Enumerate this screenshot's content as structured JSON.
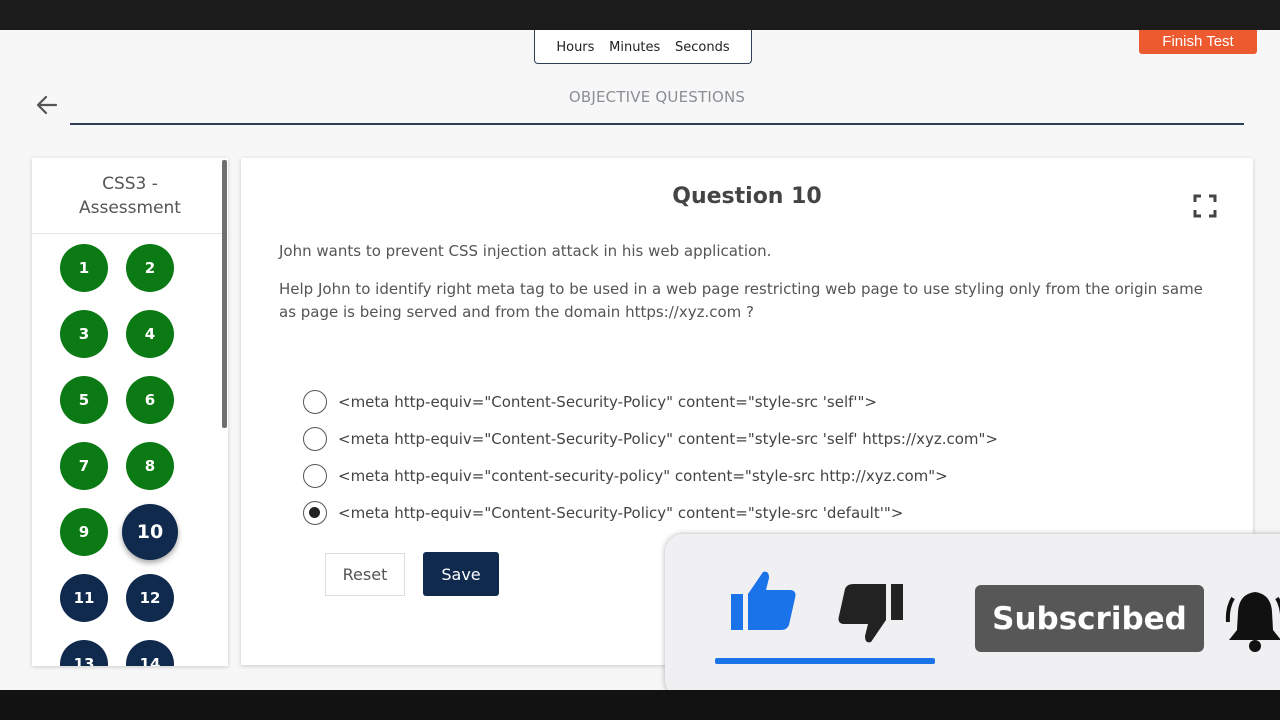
{
  "timer": {
    "hours_label": "Hours",
    "minutes_label": "Minutes",
    "seconds_label": "Seconds"
  },
  "header": {
    "finish_label": "Finish Test",
    "section_title": "OBJECTIVE QUESTIONS"
  },
  "sidebar": {
    "title": "CSS3 -\nAssessment",
    "questions": [
      {
        "n": "1",
        "state": "answered"
      },
      {
        "n": "2",
        "state": "answered"
      },
      {
        "n": "3",
        "state": "answered"
      },
      {
        "n": "4",
        "state": "answered"
      },
      {
        "n": "5",
        "state": "answered"
      },
      {
        "n": "6",
        "state": "answered"
      },
      {
        "n": "7",
        "state": "answered"
      },
      {
        "n": "8",
        "state": "answered"
      },
      {
        "n": "9",
        "state": "answered"
      },
      {
        "n": "10",
        "state": "current"
      },
      {
        "n": "11",
        "state": "unanswered"
      },
      {
        "n": "12",
        "state": "unanswered"
      },
      {
        "n": "13",
        "state": "unanswered"
      },
      {
        "n": "14",
        "state": "unanswered"
      }
    ]
  },
  "question": {
    "title": "Question 10",
    "line1": "John wants to prevent CSS injection attack in his web application.",
    "line2": "Help John to identify right meta tag to be used in a web page restricting web page to use styling only from the origin same as page is being served and from the domain https://xyz.com ?",
    "options": [
      "<meta http-equiv=\"Content-Security-Policy\" content=\"style-src 'self'\">",
      "<meta http-equiv=\"Content-Security-Policy\" content=\"style-src 'self' https://xyz.com\">",
      "<meta http-equiv=\"content-security-policy\" content=\"style-src http://xyz.com\">",
      "<meta http-equiv=\"Content-Security-Policy\" content=\"style-src 'default'\">"
    ],
    "selected_option": 4,
    "reset_label": "Reset",
    "save_label": "Save"
  },
  "overlay": {
    "subscribed_label": "Subscribed"
  },
  "colors": {
    "answered": "#0b7a14",
    "unanswered": "#102a4e",
    "finish": "#ee5a2f",
    "like": "#1a73e8"
  }
}
